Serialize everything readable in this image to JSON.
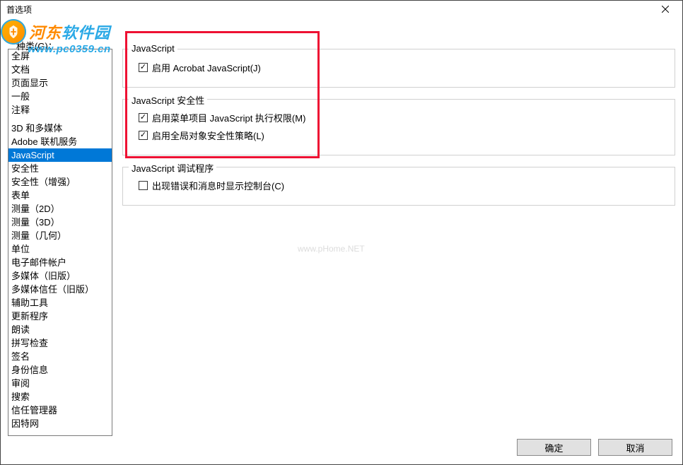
{
  "window": {
    "title": "首选项"
  },
  "category_label": "种类(G)：",
  "categories_group1": [
    "全屏",
    "文档",
    "页面显示",
    "一般",
    "注释"
  ],
  "categories_group2": [
    "3D 和多媒体",
    "Adobe 联机服务",
    "JavaScript",
    "安全性",
    "安全性（增强）",
    "表单",
    "测量（2D）",
    "测量（3D）",
    "测量（几何）",
    "单位",
    "电子邮件帐户",
    "多媒体（旧版）",
    "多媒体信任（旧版）",
    "辅助工具",
    "更新程序",
    "朗读",
    "拼写检查",
    "签名",
    "身份信息",
    "审阅",
    "搜索",
    "信任管理器",
    "因特网"
  ],
  "selected_category": "JavaScript",
  "panel": {
    "section1": {
      "title": "JavaScript",
      "items": [
        {
          "label": "启用 Acrobat JavaScript(J)",
          "checked": true
        }
      ]
    },
    "section2": {
      "title": "JavaScript 安全性",
      "items": [
        {
          "label": "启用菜单项目 JavaScript 执行权限(M)",
          "checked": true
        },
        {
          "label": "启用全局对象安全性策略(L)",
          "checked": true
        }
      ]
    },
    "section3": {
      "title": "JavaScript 调试程序",
      "items": [
        {
          "label": "出现错误和消息时显示控制台(C)",
          "checked": false
        }
      ]
    }
  },
  "buttons": {
    "ok": "确定",
    "cancel": "取消"
  },
  "watermark": {
    "brand1": "河东",
    "brand2": "软件园",
    "url": "www.pc0359.cn",
    "center": "www.pHome.NET"
  }
}
